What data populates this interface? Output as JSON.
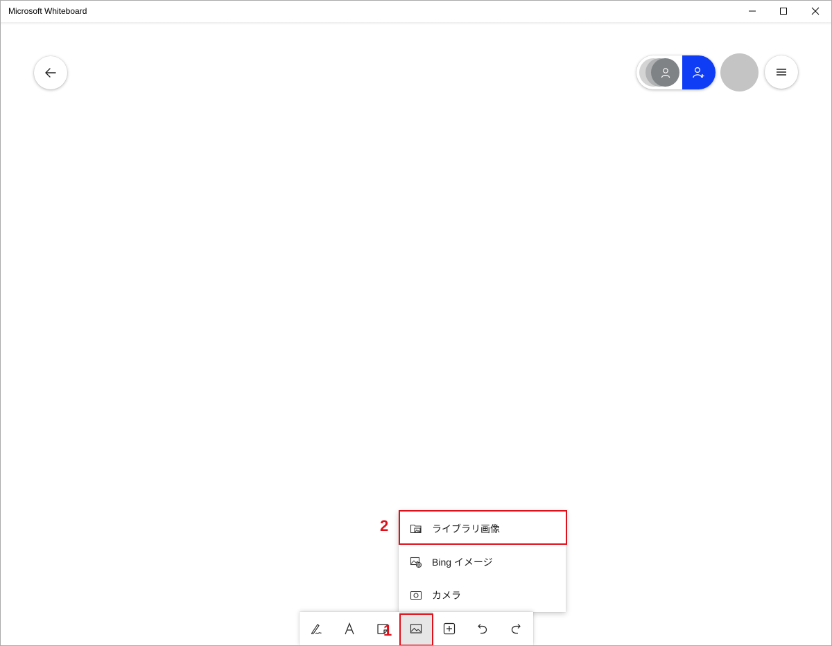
{
  "window": {
    "title": "Microsoft Whiteboard",
    "controls": [
      "minimize-icon",
      "maximize-icon",
      "close-icon"
    ]
  },
  "header": {
    "back_icon": "arrow-left-icon",
    "invite_icon": "person-add-icon",
    "menu_icon": "hamburger-icon",
    "invite_color": "#0f3cf5",
    "avatar_color": "#c4c4c4"
  },
  "insert_menu": {
    "items": [
      {
        "label": "ライブラリ画像",
        "icon": "folder-image-icon"
      },
      {
        "label": "Bing イメージ",
        "icon": "web-image-icon"
      },
      {
        "label": "カメラ",
        "icon": "camera-icon"
      }
    ]
  },
  "toolbar": {
    "tools": [
      {
        "name": "pen",
        "icon": "pen-icon"
      },
      {
        "name": "text",
        "icon": "text-icon"
      },
      {
        "name": "note",
        "icon": "sticky-note-icon"
      },
      {
        "name": "image",
        "icon": "image-icon",
        "active": true
      },
      {
        "name": "insert",
        "icon": "plus-box-icon"
      },
      {
        "name": "undo",
        "icon": "undo-icon"
      },
      {
        "name": "redo",
        "icon": "redo-icon"
      }
    ]
  },
  "annotations": {
    "step1": "1",
    "step2": "2",
    "highlight_color": "#e0101a"
  }
}
